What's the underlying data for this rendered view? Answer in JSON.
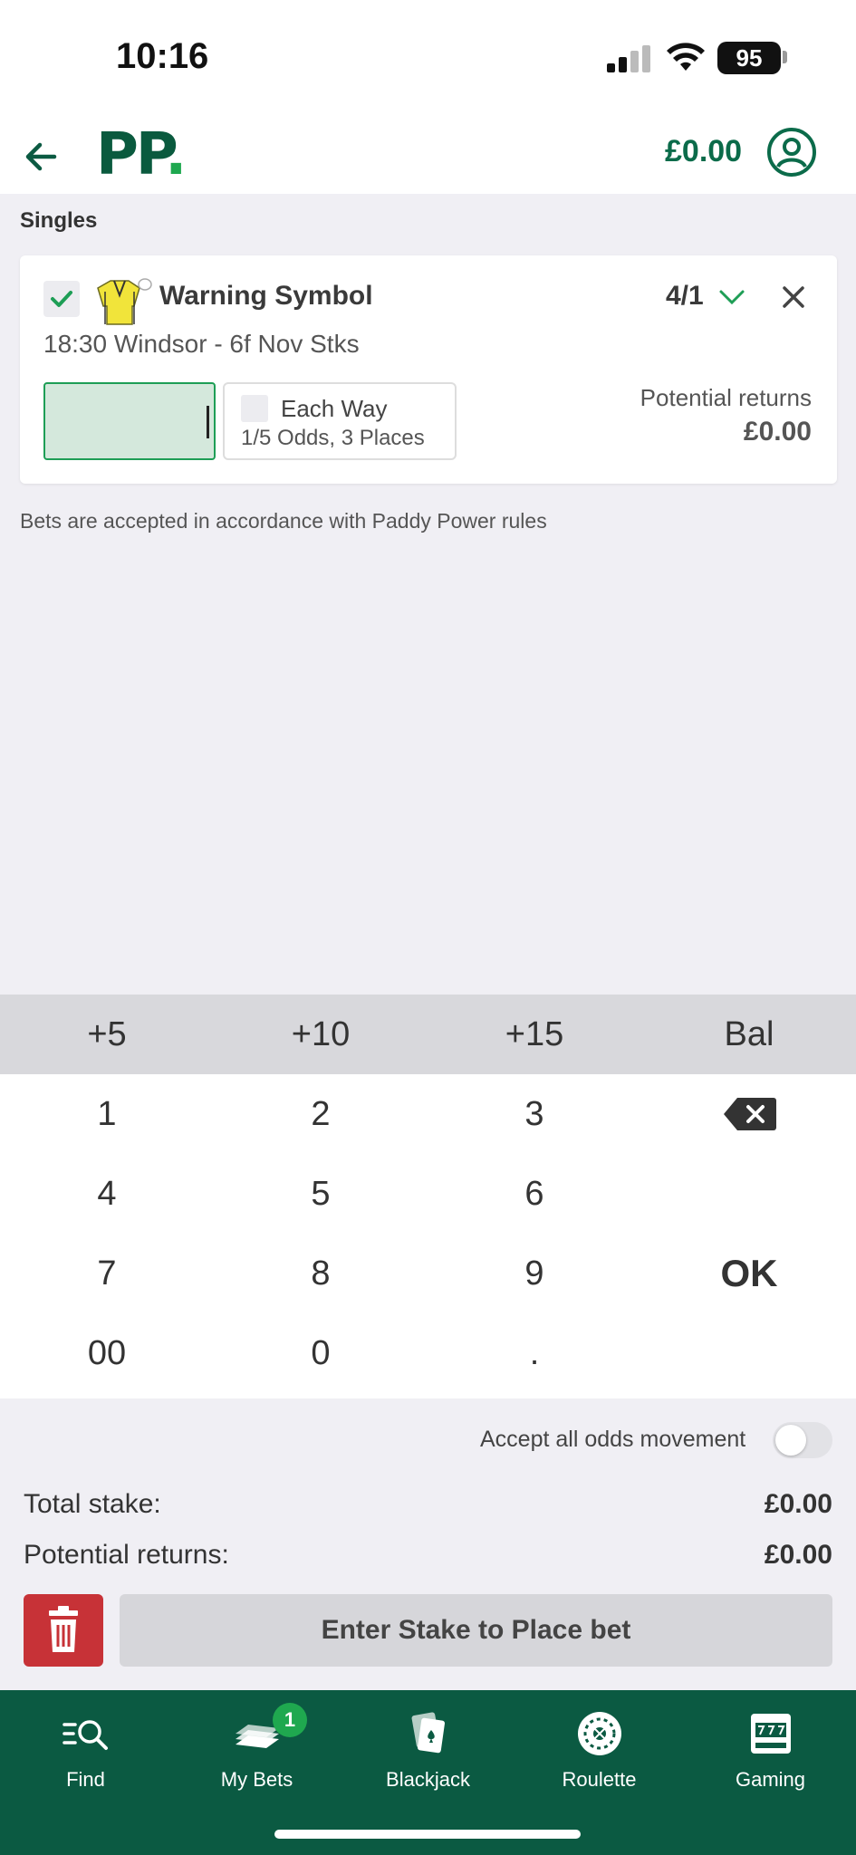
{
  "status_bar": {
    "time": "10:16",
    "battery": "95"
  },
  "header": {
    "balance": "£0.00"
  },
  "section_title": "Singles",
  "bet": {
    "runner": "Warning Symbol",
    "odds": "4/1",
    "race": "18:30 Windsor - 6f Nov Stks",
    "each_way_label": "Each Way",
    "each_way_terms": "1/5 Odds, 3 Places",
    "potential_returns_label": "Potential returns",
    "potential_returns_value": "£0.00"
  },
  "rules_note": "Bets are accepted in accordance with Paddy Power rules",
  "quick_stakes": [
    "+5",
    "+10",
    "+15",
    "Bal"
  ],
  "keypad": {
    "keys": [
      "1",
      "2",
      "3",
      "4",
      "5",
      "6",
      "7",
      "8",
      "9",
      "00",
      "0",
      "."
    ],
    "ok": "OK"
  },
  "summary": {
    "accept_odds_label": "Accept all odds movement",
    "total_stake_label": "Total stake:",
    "total_stake_value": "£0.00",
    "potential_returns_label": "Potential returns:",
    "potential_returns_value": "£0.00",
    "place_bet_label": "Enter Stake to Place bet"
  },
  "nav": {
    "items": [
      {
        "label": "Find",
        "icon": "find-icon"
      },
      {
        "label": "My Bets",
        "icon": "my-bets-icon",
        "badge": "1"
      },
      {
        "label": "Blackjack",
        "icon": "blackjack-icon"
      },
      {
        "label": "Roulette",
        "icon": "roulette-icon"
      },
      {
        "label": "Gaming",
        "icon": "gaming-icon"
      }
    ]
  },
  "colors": {
    "brand_green": "#0b5a42",
    "accent_green": "#1fa84f",
    "delete_red": "#c73237"
  }
}
